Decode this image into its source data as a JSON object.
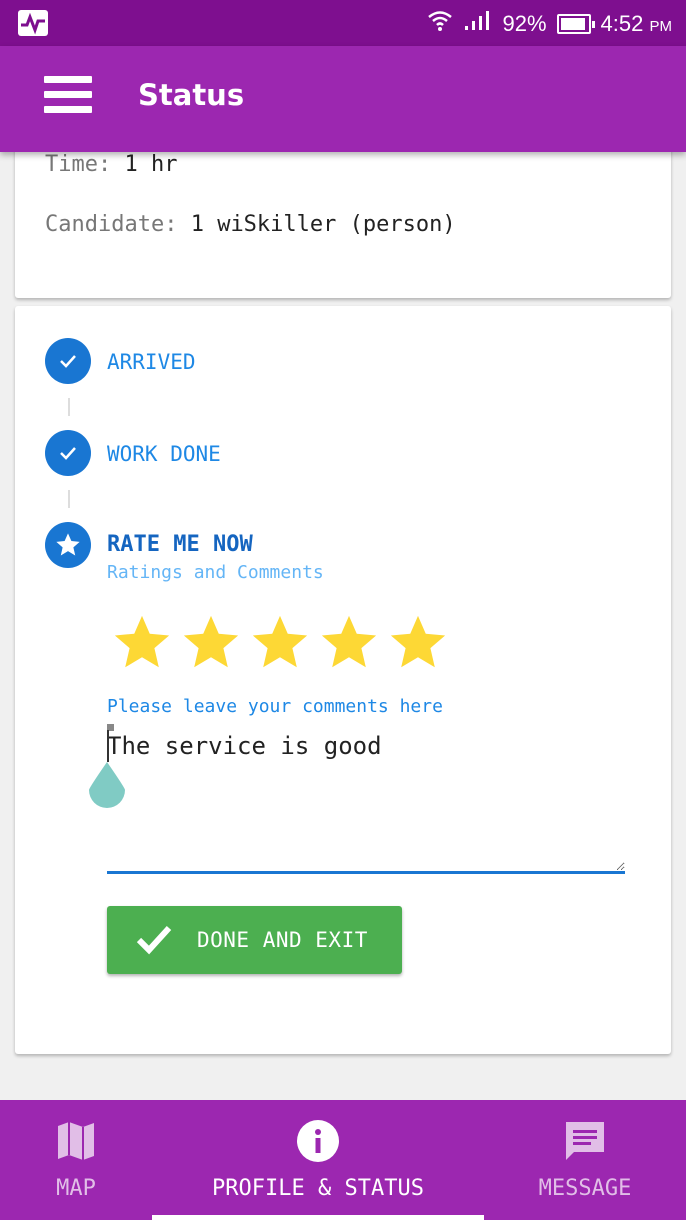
{
  "status_bar": {
    "battery": "92%",
    "time": "4:52",
    "ampm": "PM"
  },
  "app_bar": {
    "title": "Status"
  },
  "details": {
    "time_label": "Time:",
    "time_value": "1 hr",
    "candidate_label": "Candidate:",
    "candidate_value": "1 wiSkiller (person)"
  },
  "steps": [
    {
      "label": "ARRIVED",
      "icon": "check-icon"
    },
    {
      "label": "WORK DONE",
      "icon": "check-icon"
    },
    {
      "label": "RATE ME NOW",
      "sublabel": "Ratings and Comments",
      "icon": "star-icon"
    }
  ],
  "rating": {
    "value": 5,
    "max": 5,
    "color": "#fdd835"
  },
  "comment": {
    "label": "Please leave your comments here",
    "value": "The service is good"
  },
  "done_button": {
    "label": "DONE AND EXIT"
  },
  "bottom_nav": {
    "items": [
      {
        "label": "MAP",
        "icon": "map-icon"
      },
      {
        "label": "PROFILE & STATUS",
        "icon": "info-icon",
        "active": true
      },
      {
        "label": "MESSAGE",
        "icon": "message-icon"
      }
    ]
  },
  "colors": {
    "primary": "#9c27b0",
    "status_bar": "#7e0f8f",
    "accent_blue": "#1976d2",
    "success": "#4caf50"
  }
}
